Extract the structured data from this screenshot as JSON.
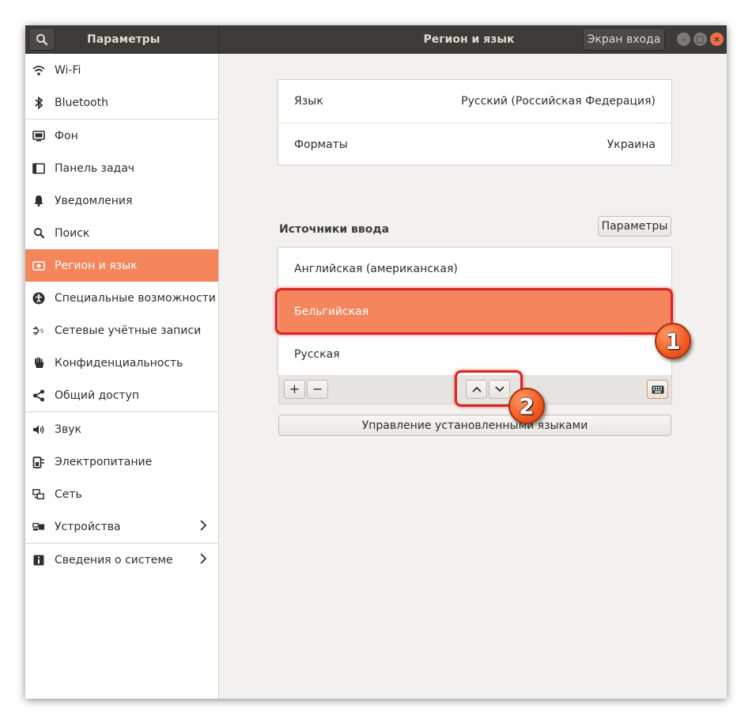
{
  "header": {
    "left_title": "Параметры",
    "main_title": "Регион и язык",
    "login_screen_button": "Экран входа"
  },
  "sidebar": {
    "items": [
      {
        "label": "Wi-Fi",
        "icon": "wifi-icon"
      },
      {
        "label": "Bluetooth",
        "icon": "bluetooth-icon"
      },
      {
        "label": "Фон",
        "icon": "background-icon"
      },
      {
        "label": "Панель задач",
        "icon": "dock-icon"
      },
      {
        "label": "Уведомления",
        "icon": "bell-icon"
      },
      {
        "label": "Поиск",
        "icon": "search-icon"
      },
      {
        "label": "Регион и язык",
        "icon": "region-icon",
        "active": true
      },
      {
        "label": "Специальные возможности",
        "icon": "accessibility-icon"
      },
      {
        "label": "Сетевые учётные записи",
        "icon": "online-accounts-icon"
      },
      {
        "label": "Конфиденциальность",
        "icon": "privacy-hand-icon"
      },
      {
        "label": "Общий доступ",
        "icon": "share-icon"
      },
      {
        "label": "Звук",
        "icon": "speaker-icon"
      },
      {
        "label": "Электропитание",
        "icon": "power-icon"
      },
      {
        "label": "Сеть",
        "icon": "network-icon"
      },
      {
        "label": "Устройства",
        "icon": "devices-icon",
        "has_submenu": true
      },
      {
        "label": "Сведения о системе",
        "icon": "info-icon",
        "has_submenu": true
      }
    ]
  },
  "main": {
    "language": {
      "label": "Язык",
      "value": "Русский (Российская Федерация)"
    },
    "formats": {
      "label": "Форматы",
      "value": "Украина"
    },
    "input_sources": {
      "title": "Источники ввода",
      "options_button": "Параметры",
      "items": [
        "Английская (американская)",
        "Бельгийская",
        "Русская"
      ],
      "selected_index": 1
    },
    "toolbar": {
      "add": "+",
      "remove": "−",
      "up": "^",
      "down": "v"
    },
    "manage_button": "Управление установленными языками"
  },
  "annotations": [
    "1",
    "2"
  ],
  "colors": {
    "accent": "#f4855d",
    "header": "#3c3b37",
    "highlight": "#e02222"
  }
}
